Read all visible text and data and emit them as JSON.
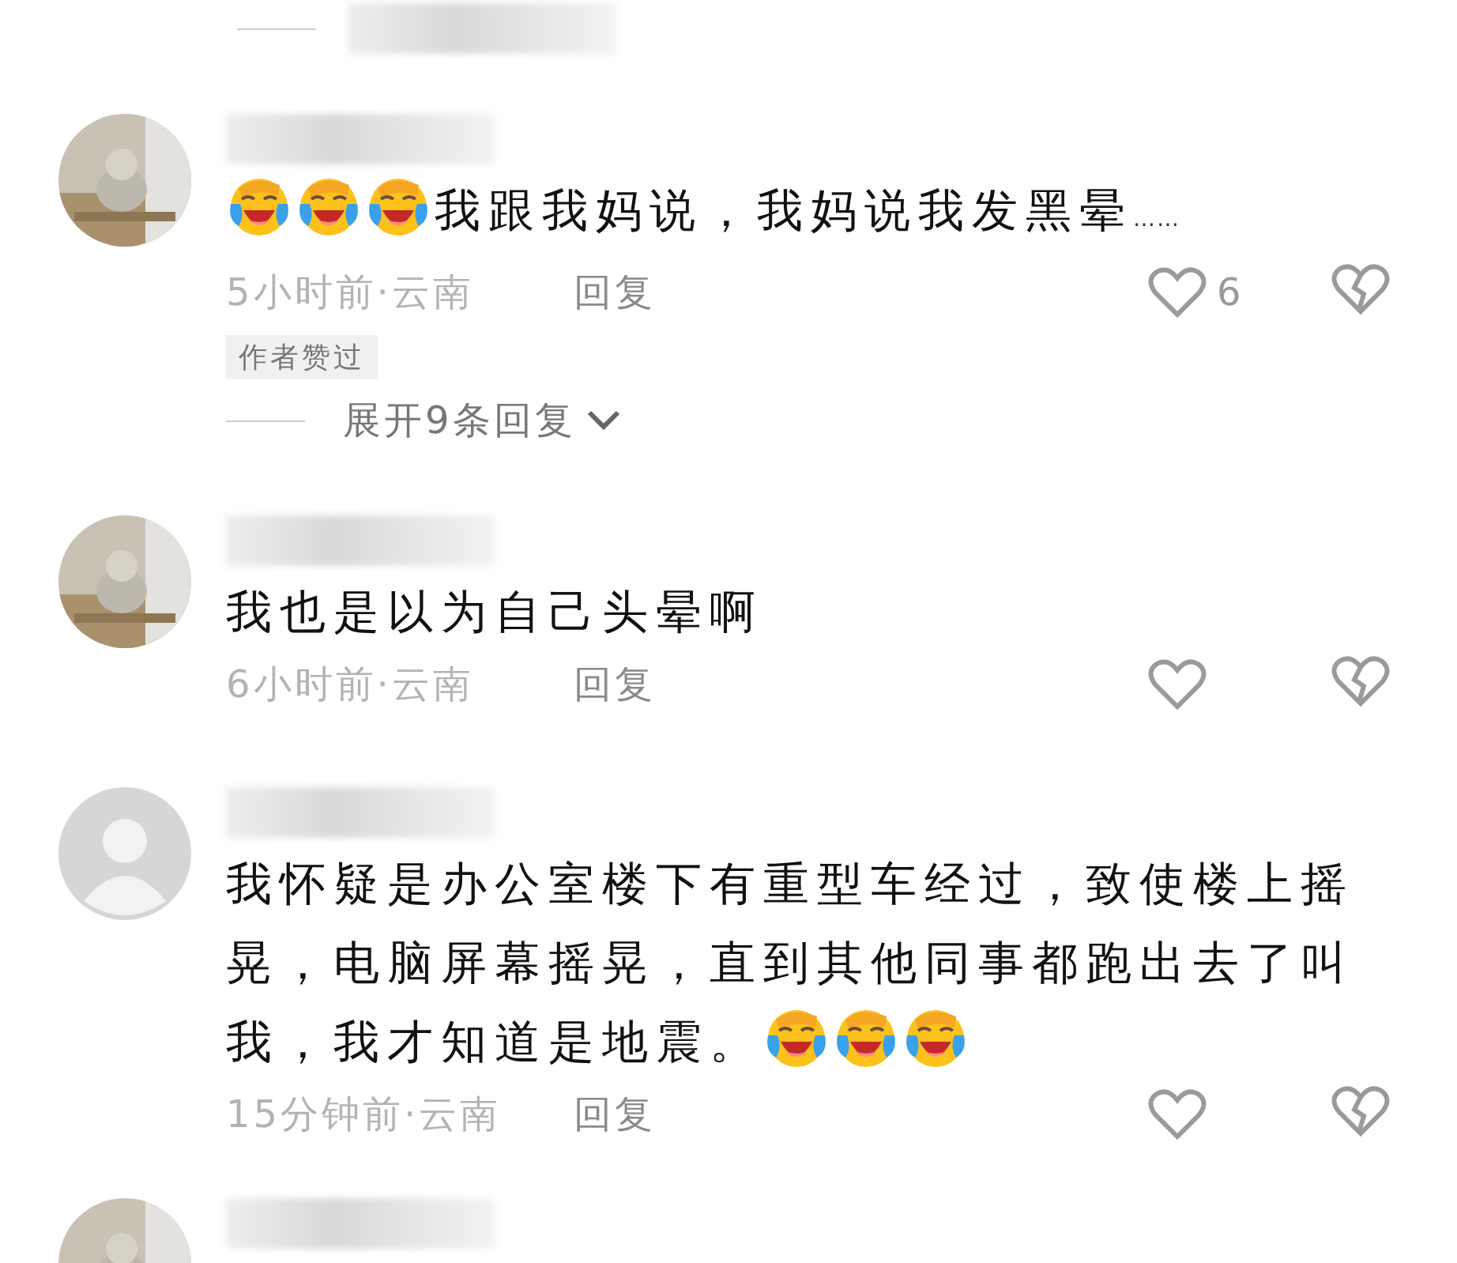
{
  "top_partial": {
    "username": {
      "kind": "blurred"
    }
  },
  "comments": [
    {
      "username": {
        "kind": "blurred"
      },
      "emojis_before": [
        {
          "kind": "crying-laughing"
        },
        {
          "kind": "crying-laughing"
        },
        {
          "kind": "crying-laughing"
        }
      ],
      "text": "我跟我妈说，我妈说我发黑晕",
      "trailing": "……",
      "time_location": "5小时前·云南",
      "reply": "回复",
      "like_count": "6",
      "author_liked": "作者赞过",
      "expand_replies": "展开9条回复"
    },
    {
      "username": {
        "kind": "blurred"
      },
      "text": "我也是以为自己头晕啊",
      "time_location": "6小时前·云南",
      "reply": "回复"
    },
    {
      "avatar": {
        "kind": "default"
      },
      "username": {
        "kind": "blurred"
      },
      "text": "我怀疑是办公室楼下有重型车经过，致使楼上摇晃，电脑屏幕摇晃，直到其他同事都跑出去了叫我，我才知道是地震。",
      "emojis_after": [
        {
          "kind": "crying-laughing"
        },
        {
          "kind": "crying-laughing"
        },
        {
          "kind": "crying-laughing"
        }
      ],
      "time_location": "15分钟前·云南",
      "reply": "回复"
    }
  ],
  "bottom_partial": {
    "username": {
      "kind": "blurred"
    }
  }
}
